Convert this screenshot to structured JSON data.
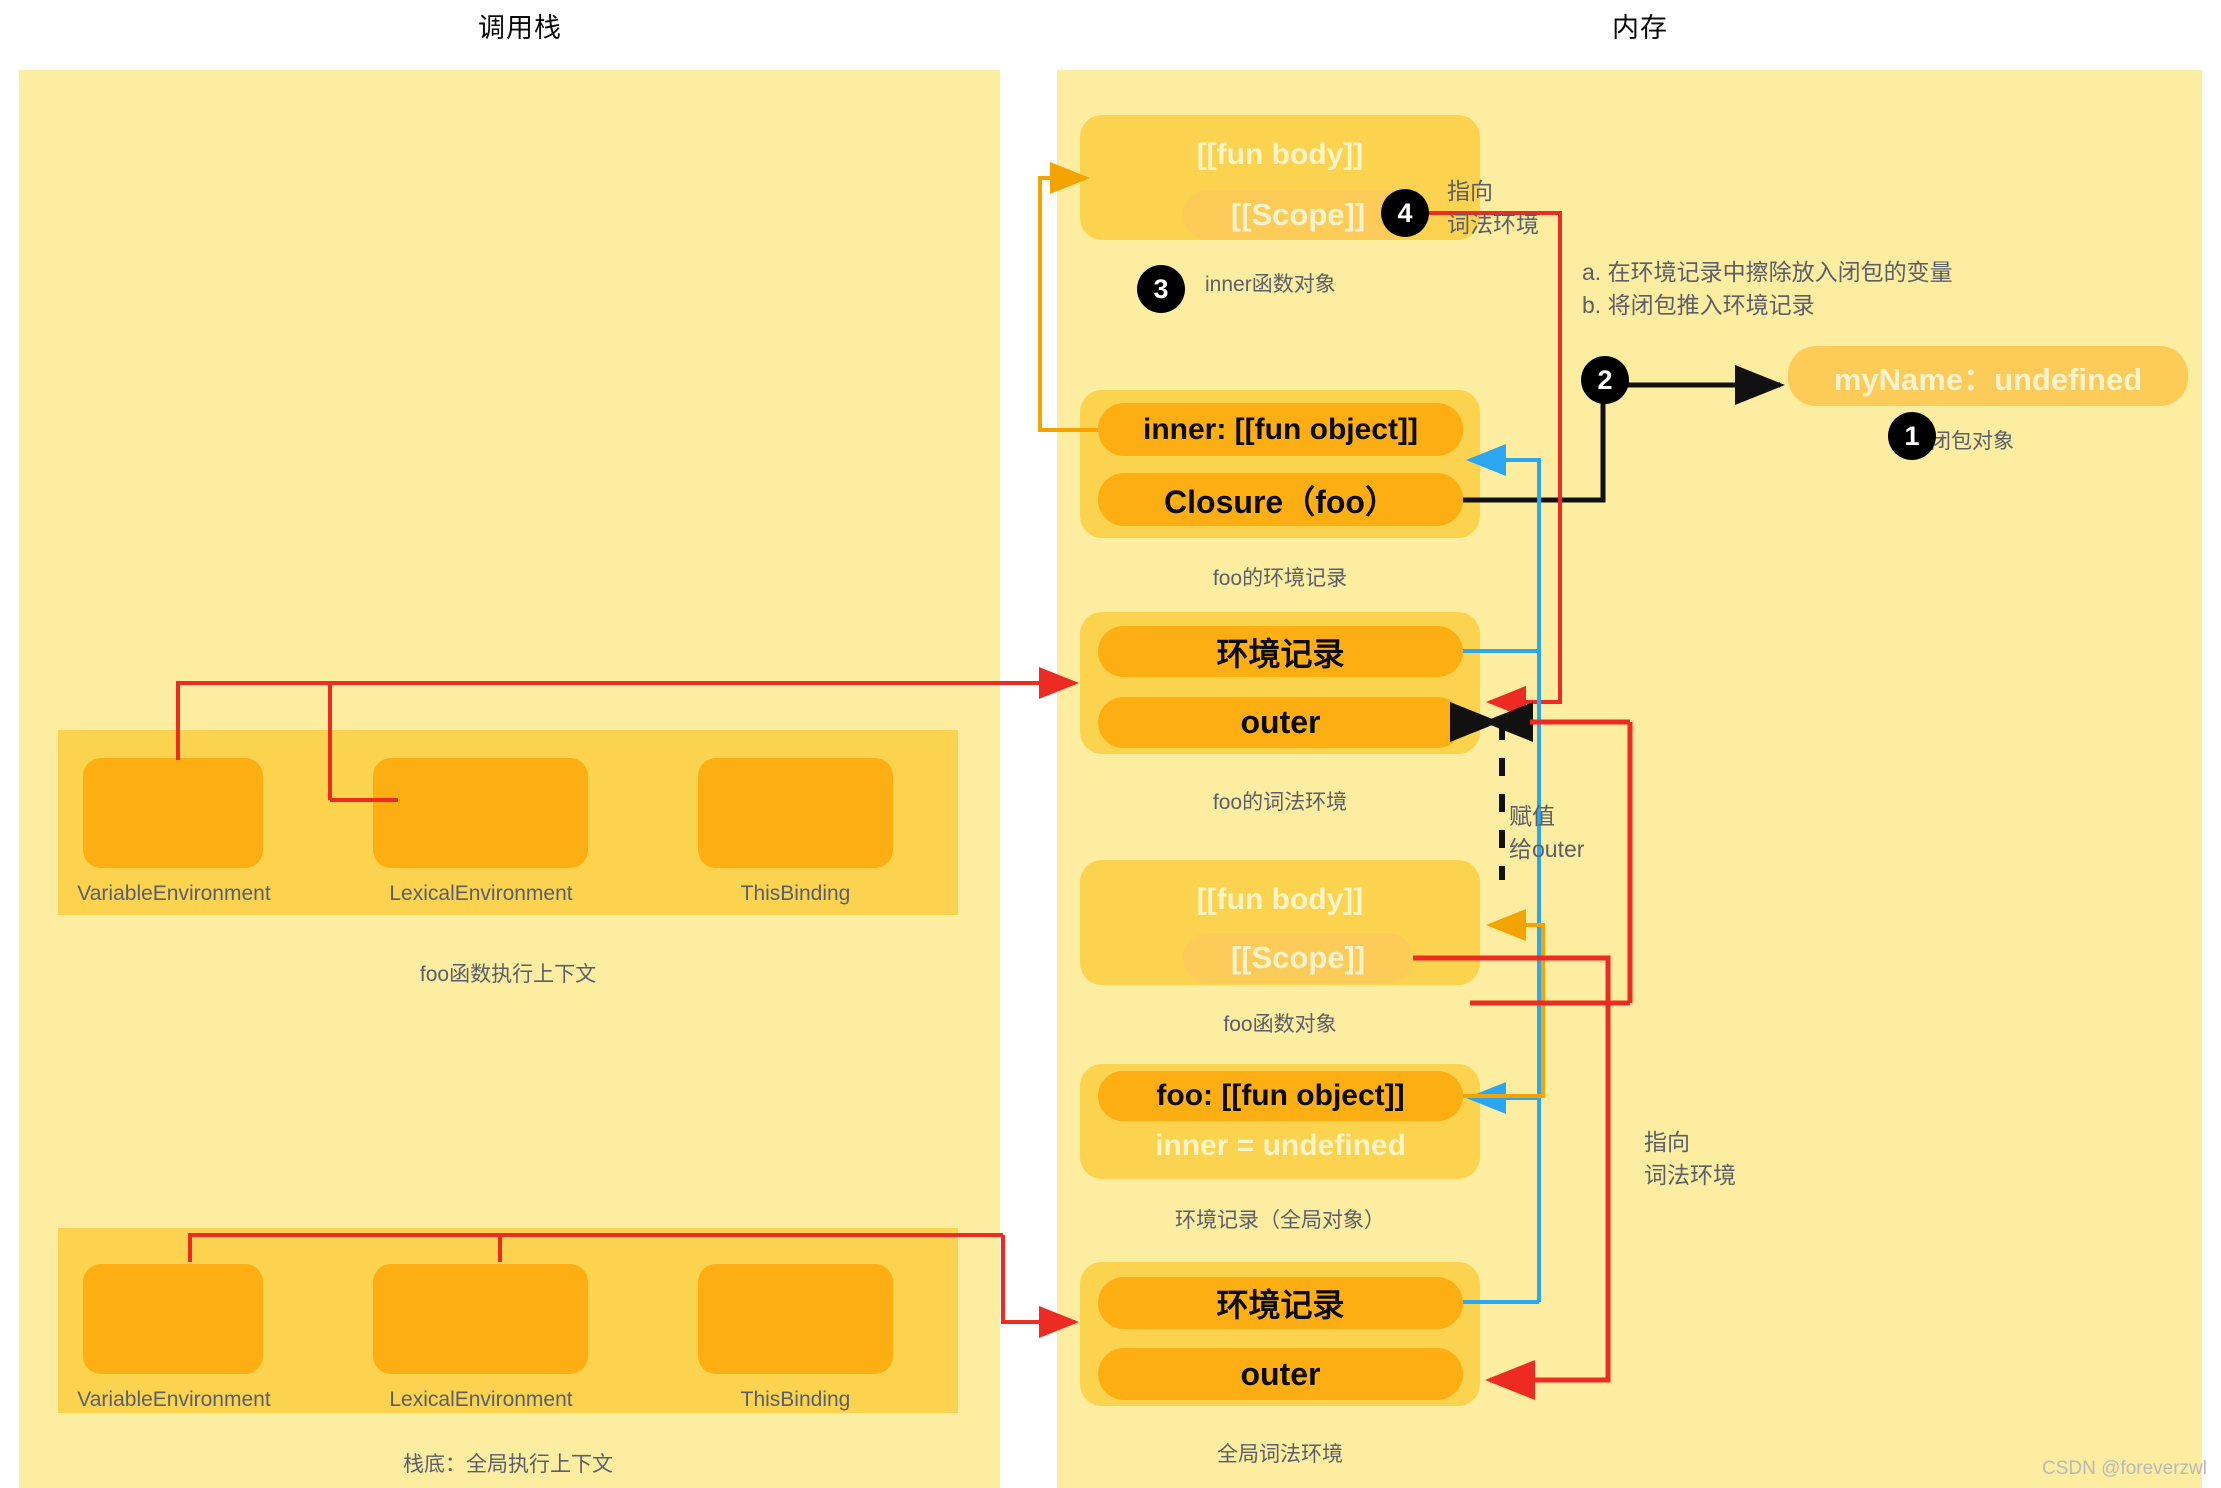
{
  "columns": {
    "call_stack_title": "调用栈",
    "memory_title": "内存"
  },
  "call_stack": {
    "contexts": [
      {
        "caption": "foo函数执行上下文",
        "slots": [
          "VariableEnvironment",
          "LexicalEnvironment",
          "ThisBinding"
        ]
      },
      {
        "caption": "栈底：全局执行上下文",
        "slots": [
          "VariableEnvironment",
          "LexicalEnvironment",
          "ThisBinding"
        ]
      }
    ]
  },
  "memory": {
    "inner_function_object": {
      "fun_body": "[[fun body]]",
      "scope": "[[Scope]]",
      "caption": "inner函数对象"
    },
    "foo_environment_record": {
      "rows": [
        "inner: [[fun object]]",
        "Closure（foo）"
      ],
      "caption": "foo的环境记录"
    },
    "foo_lexical_environment": {
      "rows": [
        "环境记录",
        "outer"
      ],
      "caption": "foo的词法环境"
    },
    "foo_function_object": {
      "fun_body": "[[fun body]]",
      "scope": "[[Scope]]",
      "caption": "foo函数对象"
    },
    "global_environment_record": {
      "rows": [
        "foo: [[fun object]]",
        "inner = undefined"
      ],
      "caption": "环境记录（全局对象）"
    },
    "global_lexical_environment": {
      "rows": [
        "环境记录",
        "outer"
      ],
      "caption": "全局词法环境"
    },
    "closure_object": {
      "label": "myName：undefined",
      "caption": "闭包对象"
    }
  },
  "badges": [
    {
      "id": "1",
      "number": "1"
    },
    {
      "id": "2",
      "number": "2"
    },
    {
      "id": "3",
      "number": "3"
    },
    {
      "id": "4",
      "number": "4"
    }
  ],
  "annotations": {
    "step4_note": "指向\n词法环境",
    "step2_note": "a. 在环境记录中擦除放入闭包的变量\nb. 将闭包推入环境记录",
    "assign_outer_note": "赋值\n给outer",
    "point_lexical_note": "指向\n词法环境"
  },
  "colors": {
    "panel_bg": "#FCEDA0",
    "block_bg": "#FBD34F",
    "row_bg": "#FCAE12",
    "row_light": "#FDCB57",
    "red": "#EE2B23",
    "orange": "#F5A300",
    "blue": "#2BA6F0",
    "black": "#111111",
    "caption": "#5b5f6b"
  },
  "watermark": "CSDN @foreverzwl"
}
